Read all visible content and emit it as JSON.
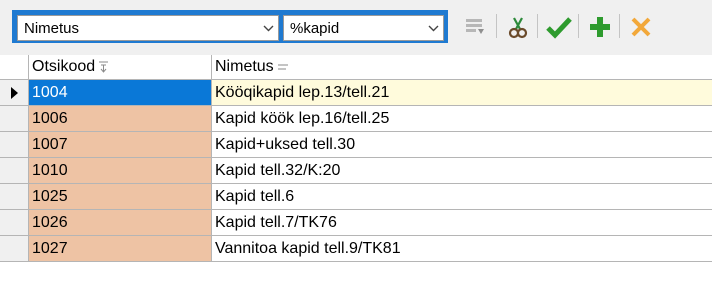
{
  "toolbar": {
    "field_select": {
      "value": "Nimetus"
    },
    "filter_select": {
      "value": "%kapid"
    },
    "buttons": [
      {
        "name": "grid-view-icon",
        "color": "#9a9a9a"
      },
      {
        "name": "cut-icon",
        "color": "#2e7d32"
      },
      {
        "name": "checkmark-icon",
        "color": "#2e9b2e"
      },
      {
        "name": "plus-icon",
        "color": "#2e9b2e"
      },
      {
        "name": "cancel-icon",
        "color": "#f0a030"
      }
    ]
  },
  "grid": {
    "columns": [
      {
        "label": "Otsikood",
        "sort_icon": "sort-indicator-icon"
      },
      {
        "label": "Nimetus",
        "sort_icon": "filter-lines-icon"
      }
    ],
    "rows": [
      {
        "code": "1004",
        "name": "Kööqikapid lep.13/tell.21",
        "current": true
      },
      {
        "code": "1006",
        "name": "Kapid köök lep.16/tell.25"
      },
      {
        "code": "1007",
        "name": "Kapid+uksed tell.30"
      },
      {
        "code": "1010",
        "name": "Kapid tell.32/K:20"
      },
      {
        "code": "1025",
        "name": "Kapid tell.6"
      },
      {
        "code": "1026",
        "name": "Kapid tell.7/TK76"
      },
      {
        "code": "1027",
        "name": "Vannitoa kapid tell.9/TK81"
      }
    ]
  },
  "colors": {
    "accent": "#1f7ad1",
    "code_cell_bg": "#eec3a4",
    "selected_code_bg": "#0a78d7",
    "current_row_bg": "#fffbdc"
  }
}
